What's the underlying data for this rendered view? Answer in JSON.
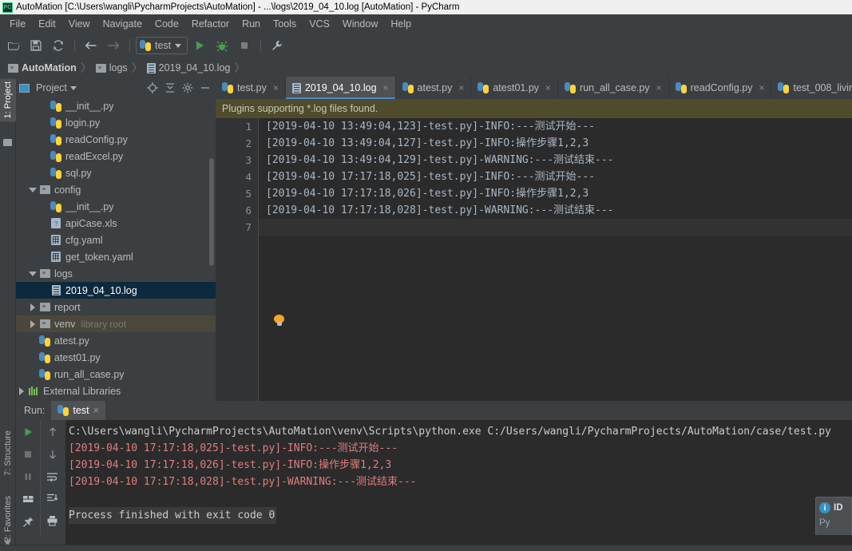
{
  "window": {
    "title": "AutoMation [C:\\Users\\wangli\\PycharmProjects\\AutoMation] - ...\\logs\\2019_04_10.log [AutoMation] - PyCharm",
    "logo": "pycharm-logo"
  },
  "menu": {
    "items": [
      "File",
      "Edit",
      "View",
      "Navigate",
      "Code",
      "Refactor",
      "Run",
      "Tools",
      "VCS",
      "Window",
      "Help"
    ]
  },
  "toolbar": {
    "open_label": "open-folder-icon",
    "save_label": "save-icon",
    "sync_label": "sync-icon",
    "back_label": "back-arrow-icon",
    "forward_label": "forward-arrow-icon",
    "run_config": "test",
    "run_label": "run-icon",
    "debug_label": "debug-icon",
    "stop_label": "stop-icon",
    "settings_label": "wrench-icon"
  },
  "breadcrumb": {
    "items": [
      "AutoMation",
      "logs",
      "2019_04_10.log"
    ],
    "separator": "〉"
  },
  "left_tool_window_bars": {
    "top": [
      "1: Project"
    ],
    "bottom": [
      "7: Structure",
      "2: Favorites"
    ]
  },
  "project_panel": {
    "title": "Project",
    "caret": "▾",
    "locate_icon": "target-icon",
    "collapse_icon": "collapse-all-icon",
    "settings_icon": "gear-icon",
    "hide_icon": "minimize-icon",
    "tree": [
      {
        "label": "__init__.py",
        "indent": 3,
        "icon": "python-file-icon",
        "twisty": "",
        "state": ""
      },
      {
        "label": "login.py",
        "indent": 3,
        "icon": "python-file-icon",
        "twisty": "",
        "state": ""
      },
      {
        "label": "readConfig.py",
        "indent": 3,
        "icon": "python-file-icon",
        "twisty": "",
        "state": ""
      },
      {
        "label": "readExcel.py",
        "indent": 3,
        "icon": "python-file-icon",
        "twisty": "",
        "state": ""
      },
      {
        "label": "sql.py",
        "indent": 3,
        "icon": "python-file-icon",
        "twisty": "",
        "state": ""
      },
      {
        "label": "config",
        "indent": 2,
        "icon": "folder-icon",
        "twisty": "down",
        "state": ""
      },
      {
        "label": "__init__.py",
        "indent": 3,
        "icon": "python-file-icon",
        "twisty": "",
        "state": ""
      },
      {
        "label": "apiCase.xls",
        "indent": 3,
        "icon": "xls-file-icon",
        "twisty": "",
        "state": ""
      },
      {
        "label": "cfg.yaml",
        "indent": 3,
        "icon": "yaml-file-icon",
        "twisty": "",
        "state": ""
      },
      {
        "label": "get_token.yaml",
        "indent": 3,
        "icon": "yaml-file-icon",
        "twisty": "",
        "state": ""
      },
      {
        "label": "logs",
        "indent": 2,
        "icon": "folder-icon",
        "twisty": "down",
        "state": ""
      },
      {
        "label": "2019_04_10.log",
        "indent": 3,
        "icon": "log-file-icon",
        "twisty": "",
        "state": "selected"
      },
      {
        "label": "report",
        "indent": 2,
        "icon": "folder-icon",
        "twisty": "right",
        "state": ""
      },
      {
        "label": "venv",
        "indent": 2,
        "icon": "folder-icon",
        "twisty": "right",
        "state": "venv",
        "sublabel": "library root"
      },
      {
        "label": "atest.py",
        "indent": 2,
        "icon": "python-file-icon",
        "twisty": "",
        "state": ""
      },
      {
        "label": "atest01.py",
        "indent": 2,
        "icon": "python-file-icon",
        "twisty": "",
        "state": ""
      },
      {
        "label": "run_all_case.py",
        "indent": 2,
        "icon": "python-file-icon",
        "twisty": "",
        "state": ""
      },
      {
        "label": "External Libraries",
        "indent": 1,
        "icon": "library-icon",
        "twisty": "right",
        "state": ""
      }
    ]
  },
  "editor": {
    "tabs": [
      {
        "label": "test.py",
        "icon": "python-file-icon",
        "active": false,
        "close": "×"
      },
      {
        "label": "2019_04_10.log",
        "icon": "log-file-icon",
        "active": true,
        "close": "×"
      },
      {
        "label": "atest.py",
        "icon": "python-file-icon",
        "active": false,
        "close": "×"
      },
      {
        "label": "atest01.py",
        "icon": "python-file-icon",
        "active": false,
        "close": "×"
      },
      {
        "label": "run_all_case.py",
        "icon": "python-file-icon",
        "active": false,
        "close": "×"
      },
      {
        "label": "readConfig.py",
        "icon": "python-file-icon",
        "active": false,
        "close": "×"
      },
      {
        "label": "test_008_livin",
        "icon": "python-file-icon",
        "active": false,
        "close": ""
      }
    ],
    "notification": "Plugins supporting *.log files found.",
    "gutter": [
      "1",
      "2",
      "3",
      "4",
      "5",
      "6",
      "7"
    ],
    "lines": [
      "[2019-04-10 13:49:04,123]-test.py]-INFO:---测试开始---",
      "[2019-04-10 13:49:04,127]-test.py]-INFO:操作步骤1,2,3",
      "[2019-04-10 13:49:04,129]-test.py]-WARNING:---测试结束---",
      "[2019-04-10 17:17:18,025]-test.py]-INFO:---测试开始---",
      "[2019-04-10 17:17:18,026]-test.py]-INFO:操作步骤1,2,3",
      "[2019-04-10 17:17:18,028]-test.py]-WARNING:---测试结束---",
      ""
    ],
    "intention_bulb": "lightbulb-icon"
  },
  "run_panel": {
    "label": "Run:",
    "tab": "test",
    "tab_close": "×",
    "tools_left": [
      "run-icon",
      "stop-icon",
      "pause-icon",
      "layout-icon",
      "pin-icon"
    ],
    "tools_right": [
      "up-arrow-icon",
      "down-arrow-icon",
      "soft-wrap-icon",
      "scroll-to-end-icon",
      "print-icon",
      "expand-icon"
    ],
    "expand_label": "»",
    "console": [
      {
        "text": "C:\\Users\\wangli\\PycharmProjects\\AutoMation\\venv\\Scripts\\python.exe C:/Users/wangli/PycharmProjects/AutoMation/case/test.py",
        "style": "cmd"
      },
      {
        "text": "[2019-04-10 17:17:18,025]-test.py]-INFO:---测试开始---",
        "style": "log"
      },
      {
        "text": "[2019-04-10 17:17:18,026]-test.py]-INFO:操作步骤1,2,3",
        "style": "log"
      },
      {
        "text": "[2019-04-10 17:17:18,028]-test.py]-WARNING:---测试结束---",
        "style": "log"
      },
      {
        "text": "",
        "style": "cmd"
      },
      {
        "text": "Process finished with exit code 0",
        "style": "done"
      }
    ]
  },
  "balloon": {
    "icon": "info-icon",
    "title": "ID",
    "body": "Py"
  },
  "colors": {
    "accent": "#4a88c7",
    "selection": "#0d293e",
    "editor_bg": "#2b2b2b",
    "panel_bg": "#3c3f41",
    "notification_bg": "#4f4b2d",
    "console_log": "#e07e7e"
  }
}
